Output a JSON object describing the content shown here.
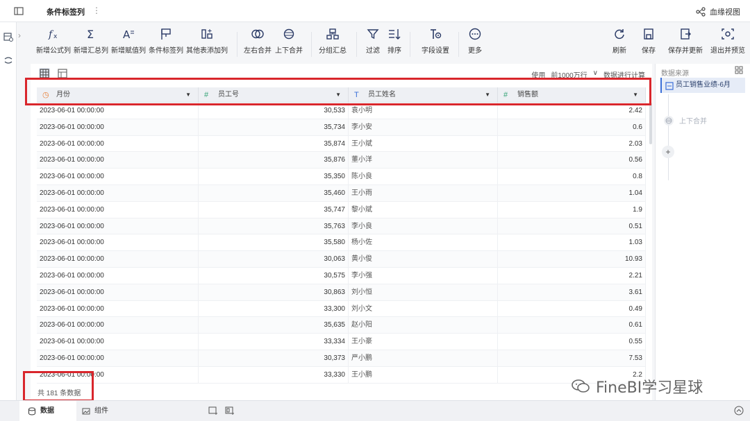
{
  "topbar": {
    "tab_title": "条件标签列",
    "tab_more": "⋮",
    "lineage_label": "血缘视图"
  },
  "toolbar": {
    "items": [
      {
        "label": "新增公式列",
        "icon": "formula-icon"
      },
      {
        "label": "新增汇总列",
        "icon": "sigma-icon"
      },
      {
        "label": "新增赋值列",
        "icon": "assign-icon"
      },
      {
        "label": "条件标签列",
        "icon": "flag-icon"
      },
      {
        "label": "其他表添加列",
        "icon": "add-column-icon"
      },
      {
        "label": "左右合并",
        "icon": "join-icon"
      },
      {
        "label": "上下合并",
        "icon": "union-icon"
      },
      {
        "label": "分组汇总",
        "icon": "group-icon"
      },
      {
        "label": "过滤",
        "icon": "filter-icon"
      },
      {
        "label": "排序",
        "icon": "sort-icon"
      },
      {
        "label": "字段设置",
        "icon": "field-settings-icon"
      },
      {
        "label": "更多",
        "icon": "more-icon"
      }
    ],
    "right_items": [
      {
        "label": "刷新",
        "icon": "refresh-icon"
      },
      {
        "label": "保存",
        "icon": "save-icon"
      },
      {
        "label": "保存并更新",
        "icon": "save-update-icon"
      },
      {
        "label": "退出并预览",
        "icon": "exit-preview-icon"
      }
    ]
  },
  "main": {
    "limit_use": "使用",
    "limit_value": "前1000万行",
    "limit_chevron": "∨",
    "limit_calc": "数据进行计算",
    "columns": [
      {
        "name": "月份",
        "type_icon": "◷",
        "type_color": "#e8813a"
      },
      {
        "name": "员工号",
        "type_icon": "#",
        "type_color": "#3aa67a"
      },
      {
        "name": "员工姓名",
        "type_icon": "T",
        "type_color": "#3a6fd8"
      },
      {
        "name": "销售额",
        "type_icon": "#",
        "type_color": "#3aa67a"
      }
    ],
    "rows": [
      [
        "2023-06-01 00:00:00",
        "30,533",
        "袁小明",
        "2.42"
      ],
      [
        "2023-06-01 00:00:00",
        "35,734",
        "李小安",
        "0.6"
      ],
      [
        "2023-06-01 00:00:00",
        "35,874",
        "王小斌",
        "2.03"
      ],
      [
        "2023-06-01 00:00:00",
        "35,876",
        "董小洋",
        "0.56"
      ],
      [
        "2023-06-01 00:00:00",
        "35,350",
        "陈小良",
        "0.8"
      ],
      [
        "2023-06-01 00:00:00",
        "35,460",
        "王小雨",
        "1.04"
      ],
      [
        "2023-06-01 00:00:00",
        "35,747",
        "黎小斌",
        "1.9"
      ],
      [
        "2023-06-01 00:00:00",
        "35,763",
        "李小良",
        "0.51"
      ],
      [
        "2023-06-01 00:00:00",
        "35,580",
        "杨小佐",
        "1.03"
      ],
      [
        "2023-06-01 00:00:00",
        "30,063",
        "黄小俊",
        "10.93"
      ],
      [
        "2023-06-01 00:00:00",
        "30,575",
        "李小强",
        "2.21"
      ],
      [
        "2023-06-01 00:00:00",
        "30,863",
        "刘小恒",
        "3.61"
      ],
      [
        "2023-06-01 00:00:00",
        "33,300",
        "刘小文",
        "0.49"
      ],
      [
        "2023-06-01 00:00:00",
        "35,635",
        "赵小阳",
        "0.61"
      ],
      [
        "2023-06-01 00:00:00",
        "33,334",
        "王小豪",
        "0.55"
      ],
      [
        "2023-06-01 00:00:00",
        "30,373",
        "严小鹏",
        "7.53"
      ],
      [
        "2023-06-01 00:00:00",
        "33,330",
        "王小鹏",
        "2.2"
      ]
    ],
    "count_text": "共 181 条数据"
  },
  "rpanel": {
    "title": "数据来源",
    "source_label": "员工销售业绩-6月",
    "merge_label": "上下合并",
    "add_label": "+"
  },
  "bottom": {
    "tab_data": "数据",
    "tab_component": "组件"
  },
  "watermark": "FineBI学习星球",
  "colors": {
    "accent": "#3a6fd8",
    "highlight_red": "#d9262c"
  }
}
